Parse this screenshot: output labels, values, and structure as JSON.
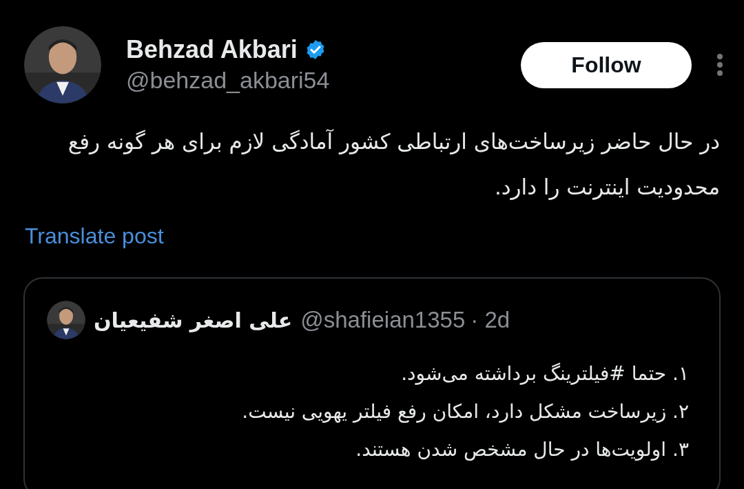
{
  "author": {
    "name": "Behzad Akbari",
    "verified": true,
    "handle": "@behzad_akbari54"
  },
  "follow_button": "Follow",
  "post_text": "در حال حاضر زیرساخت‌های ارتباطی کشور آمادگی لازم برای هر گونه رفع محدودیت اینترنت را دارد.",
  "translate_link": "Translate post",
  "quoted_post": {
    "name": "علی اصغر شفیعیان",
    "handle": "@shafieian1355",
    "time": "· 2d",
    "lines": [
      "۱. حتما #فیلترینگ برداشته می‌شود.",
      "۲. زیرساخت مشکل دارد، امکان رفع فیلتر یهویی نیست.",
      "۳. اولویت‌ها در حال مشخص شدن هستند."
    ]
  }
}
